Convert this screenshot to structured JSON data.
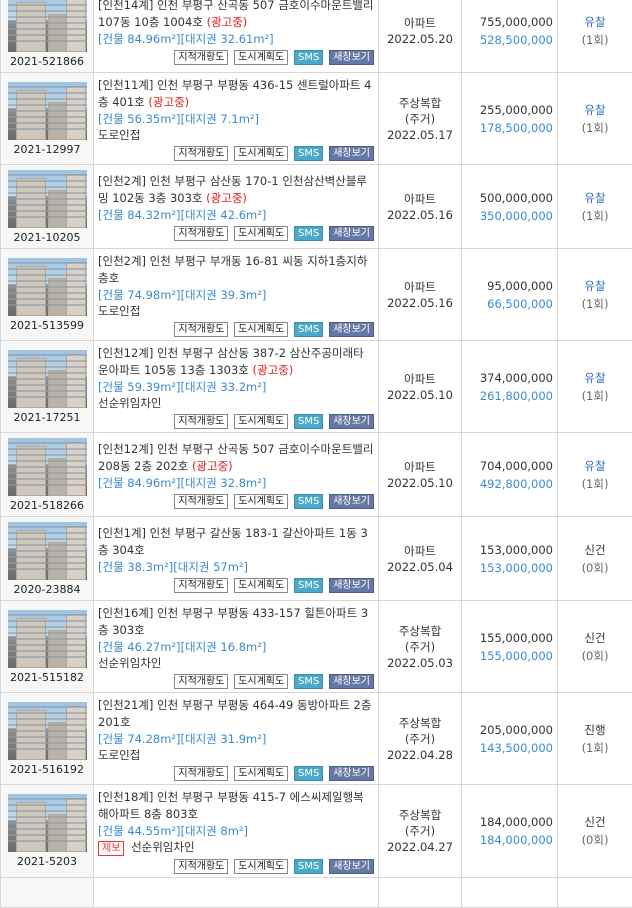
{
  "buttons": {
    "jijeok": "지적개황도",
    "dosi": "도시계획도",
    "sms": "SMS",
    "new_window": "새창보기"
  },
  "listings": [
    {
      "case_no": "2021-521866",
      "title": "[인천14계] 인천 부평구 산곡동 507 금호이수마운트밸리 107동 10층 1004호",
      "ad": "(광고중)",
      "area": "[건물 84.96m²][대지권 32.61m²]",
      "note": "",
      "jebo": "",
      "type": [
        "아파트"
      ],
      "date": "2022.05.20",
      "appraisal": "755,000,000",
      "minimum": "528,500,000",
      "status": "유찰",
      "status_kind": "y",
      "count": "(1회)"
    },
    {
      "case_no": "2021-12997",
      "title": "[인천11계] 인천 부평구 부평동 436-15 센트럴아파트 4층 401호",
      "ad": "(광고중)",
      "area": "[건물 56.35m²][대지권 7.1m²]",
      "note": "도로인접",
      "jebo": "",
      "type": [
        "주상복합",
        "(주거)"
      ],
      "date": "2022.05.17",
      "appraisal": "255,000,000",
      "minimum": "178,500,000",
      "status": "유찰",
      "status_kind": "y",
      "count": "(1회)"
    },
    {
      "case_no": "2021-10205",
      "title": "[인천2계] 인천 부평구 삼산동 170-1 인천삼산벽산블루밍 102동 3층 303호",
      "ad": "(광고중)",
      "area": "[건물 84.32m²][대지권 42.6m²]",
      "note": "",
      "jebo": "",
      "type": [
        "아파트"
      ],
      "date": "2022.05.16",
      "appraisal": "500,000,000",
      "minimum": "350,000,000",
      "status": "유찰",
      "status_kind": "y",
      "count": "(1회)"
    },
    {
      "case_no": "2021-513599",
      "title": "[인천2계] 인천 부평구 부개동 16-81 씨동 지하1층지하층호",
      "ad": "",
      "area": "[건물 74.98m²][대지권 39.3m²]",
      "note": "도로인접",
      "jebo": "",
      "type": [
        "아파트"
      ],
      "date": "2022.05.16",
      "appraisal": "95,000,000",
      "minimum": "66,500,000",
      "status": "유찰",
      "status_kind": "y",
      "count": "(1회)"
    },
    {
      "case_no": "2021-17251",
      "title": "[인천12계] 인천 부평구 삼산동 387-2 삼산주공미래타운아파트 105동 13층 1303호",
      "ad": "(광고중)",
      "area": "[건물 59.39m²][대지권 33.2m²]",
      "note": "선순위임차인",
      "jebo": "",
      "type": [
        "아파트"
      ],
      "date": "2022.05.10",
      "appraisal": "374,000,000",
      "minimum": "261,800,000",
      "status": "유찰",
      "status_kind": "y",
      "count": "(1회)"
    },
    {
      "case_no": "2021-518266",
      "title": "[인천12계] 인천 부평구 산곡동 507 금호이수마운트밸리 208동 2층 202호",
      "ad": "(광고중)",
      "area": "[건물 84.96m²][대지권 32.8m²]",
      "note": "",
      "jebo": "",
      "type": [
        "아파트"
      ],
      "date": "2022.05.10",
      "appraisal": "704,000,000",
      "minimum": "492,800,000",
      "status": "유찰",
      "status_kind": "y",
      "count": "(1회)"
    },
    {
      "case_no": "2020-23884",
      "title": "[인천1계] 인천 부평구 갈산동 183-1 갈산아파트 1동 3층 304호",
      "ad": "",
      "area": "[건물 38.3m²][대지권 57m²]",
      "note": "",
      "jebo": "",
      "type": [
        "아파트"
      ],
      "date": "2022.05.04",
      "appraisal": "153,000,000",
      "minimum": "153,000,000",
      "status": "신건",
      "status_kind": "n",
      "count": "(0회)"
    },
    {
      "case_no": "2021-515182",
      "title": "[인천16계] 인천 부평구 부평동 433-157 힐튼아파트 3층 303호",
      "ad": "",
      "area": "[건물 46.27m²][대지권 16.8m²]",
      "note": "선순위임차인",
      "jebo": "",
      "type": [
        "주상복합",
        "(주거)"
      ],
      "date": "2022.05.03",
      "appraisal": "155,000,000",
      "minimum": "155,000,000",
      "status": "신건",
      "status_kind": "n",
      "count": "(0회)"
    },
    {
      "case_no": "2021-516192",
      "title": "[인천21계] 인천 부평구 부평동 464-49 동방아파트 2층 201호",
      "ad": "",
      "area": "[건물 74.28m²][대지권 31.9m²]",
      "note": "도로인접",
      "jebo": "",
      "type": [
        "주상복합",
        "(주거)"
      ],
      "date": "2022.04.28",
      "appraisal": "205,000,000",
      "minimum": "143,500,000",
      "status": "진행",
      "status_kind": "n",
      "count": "(1회)"
    },
    {
      "case_no": "2021-5203",
      "title": "[인천18계] 인천 부평구 부평동 415-7 에스씨제일행복해아파트 8층 803호",
      "ad": "",
      "area": "[건물 44.55m²][대지권 8m²]",
      "note": "선순위임차인",
      "jebo": "제보",
      "type": [
        "주상복합",
        "(주거)"
      ],
      "date": "2022.04.27",
      "appraisal": "184,000,000",
      "minimum": "184,000,000",
      "status": "신건",
      "status_kind": "n",
      "count": "(0회)"
    }
  ]
}
